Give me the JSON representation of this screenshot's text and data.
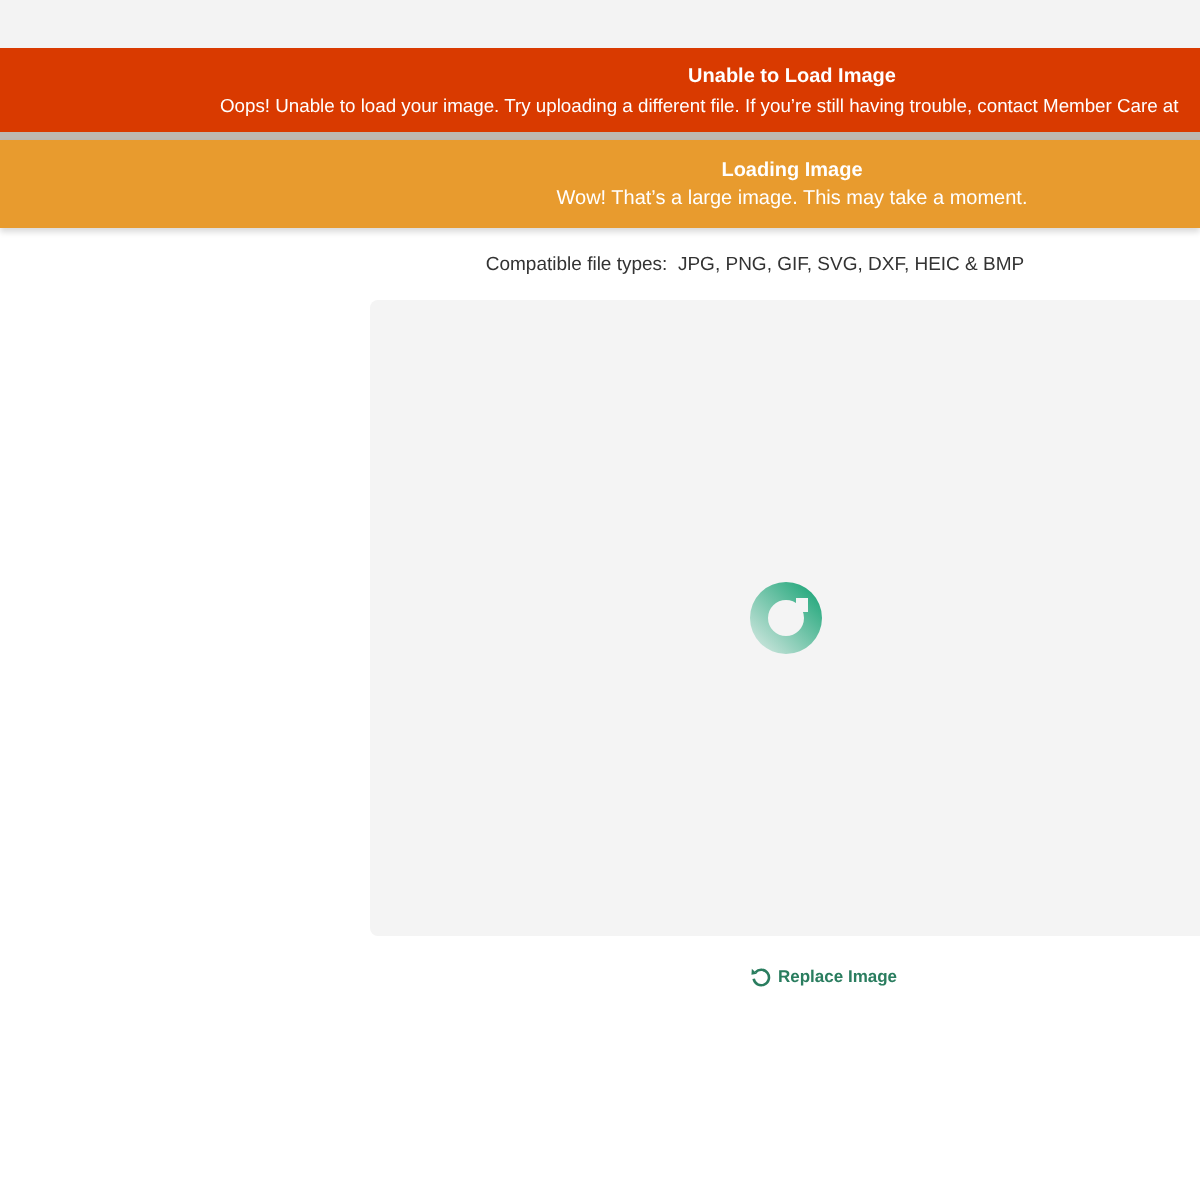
{
  "banners": [
    {
      "kind": "error",
      "title": "Unable to Load Image",
      "message": "Oops! Unable to load your image. Try uploading a different file. If you’re still having trouble, contact Member Care at"
    },
    {
      "kind": "warning",
      "title": "Loading Image",
      "message": "Wow! That’s a large image. This may take a moment."
    }
  ],
  "upload": {
    "file_types_label": "Compatible file types:",
    "file_types": "JPG, PNG, GIF, SVG, DXF, HEIC & BMP",
    "loading": true,
    "replace_button": "Replace Image"
  }
}
